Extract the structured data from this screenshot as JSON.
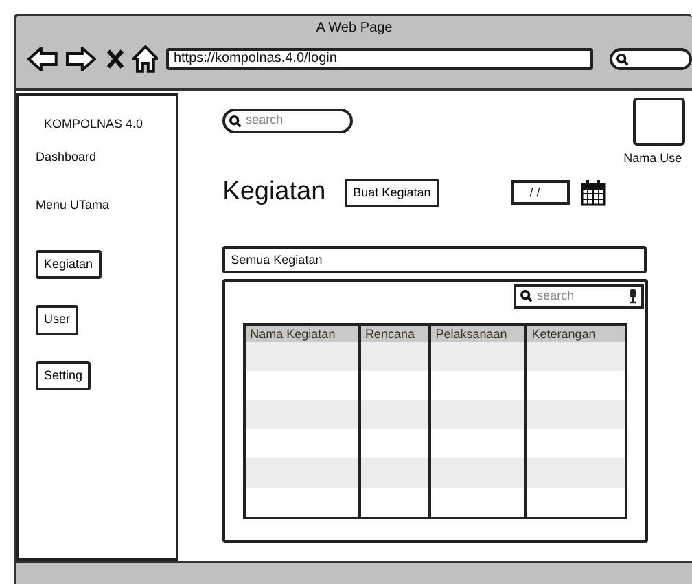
{
  "window": {
    "title": "A Web Page"
  },
  "browser": {
    "url": "https://kompolnas.4.0/login"
  },
  "sidebar": {
    "brand": "KOMPOLNAS 4.0",
    "items": [
      {
        "label": "Dashboard",
        "kind": "link"
      },
      {
        "label": "Menu UTama",
        "kind": "link"
      },
      {
        "label": "Kegiatan",
        "kind": "button"
      },
      {
        "label": "User",
        "kind": "button"
      },
      {
        "label": "Setting",
        "kind": "button"
      }
    ]
  },
  "top_search": {
    "placeholder": "search"
  },
  "user": {
    "name": "Nama Use"
  },
  "page": {
    "title": "Kegiatan",
    "create_button": "Buat Kegiatan",
    "date_field": {
      "value": "/ /"
    }
  },
  "filter": {
    "value": "Semua Kegiatan"
  },
  "table": {
    "search": {
      "placeholder": "search"
    },
    "columns": [
      "Nama Kegiatan",
      "Rencana",
      "Pelaksanaan",
      "Keterangan"
    ]
  }
}
